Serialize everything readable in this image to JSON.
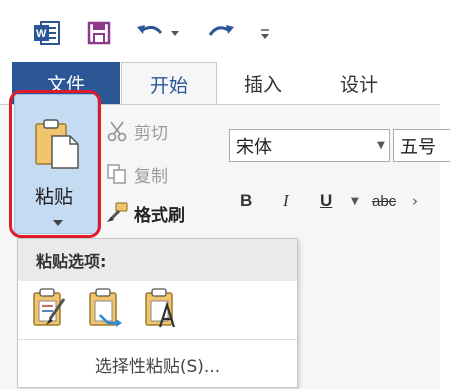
{
  "quick_access": {
    "icons": [
      "word-logo-icon",
      "save-icon",
      "undo-icon",
      "redo-icon",
      "customize-qat-icon"
    ]
  },
  "tabs": {
    "file": "文件",
    "home": "开始",
    "insert": "插入",
    "design": "设计"
  },
  "clipboard": {
    "paste_label": "粘贴",
    "cut_label": "剪切",
    "copy_label": "复制",
    "format_painter_label": "格式刷"
  },
  "font": {
    "name": "宋体",
    "size": "五号"
  },
  "format_buttons": {
    "bold": "B",
    "italic": "I",
    "underline": "U",
    "strikethrough": "abc"
  },
  "paste_menu": {
    "header": "粘贴选项:",
    "options": [
      "keep-source-formatting-icon",
      "merge-formatting-icon",
      "keep-text-only-icon"
    ],
    "paste_special": "选择性粘贴(S)..."
  },
  "colors": {
    "file_tab": "#2b5797",
    "highlight": "#c5dbf2",
    "callout_red": "#e01a2b"
  }
}
